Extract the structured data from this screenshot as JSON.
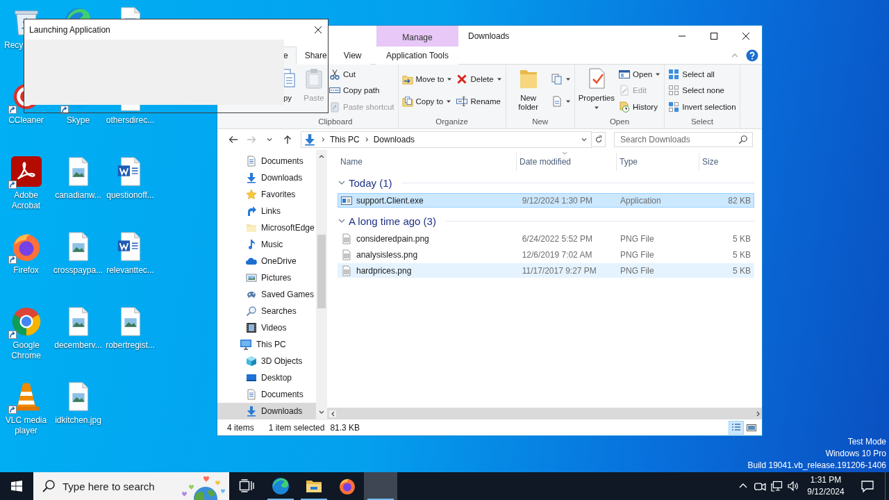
{
  "desktop": {
    "icons": [
      {
        "kind": "recycle",
        "label": "Recy",
        "shortcut": false
      },
      {
        "kind": "ccleaner",
        "label": "CCleaner",
        "shortcut": true
      },
      {
        "kind": "acrobat",
        "label": "Adobe Acrobat",
        "shortcut": true
      },
      {
        "kind": "firefox",
        "label": "Firefox",
        "shortcut": true
      },
      {
        "kind": "chrome",
        "label": "Google Chrome",
        "shortcut": true
      },
      {
        "kind": "vlc",
        "label": "VLC media player",
        "shortcut": true
      },
      {
        "kind": "edge",
        "shortcut": false
      },
      {
        "kind": "skype",
        "label": "Skype",
        "shortcut": true
      },
      {
        "kind": "image",
        "label": "canadianw...",
        "shortcut": false
      },
      {
        "kind": "image",
        "label": "crosspaypa...",
        "shortcut": false
      },
      {
        "kind": "image",
        "label": "decemberv...",
        "shortcut": false
      },
      {
        "kind": "image",
        "label": "idkitchen.jpg",
        "shortcut": false
      },
      {
        "kind": "image",
        "shortcut": false
      },
      {
        "kind": "image",
        "label": "othersdirec...",
        "shortcut": false
      },
      {
        "kind": "word",
        "label": "questionoff...",
        "shortcut": false
      },
      {
        "kind": "word",
        "label": "relevanttec...",
        "shortcut": false
      },
      {
        "kind": "image",
        "label": "robertregist...",
        "shortcut": false
      }
    ],
    "system_lines": [
      "Test Mode",
      "Windows 10 Pro",
      "Build 19041.vb_release.191206-1406"
    ]
  },
  "dialog": {
    "title": "Launching Application"
  },
  "explorer": {
    "context_header": "Manage",
    "title": "Downloads",
    "tabs": [
      {
        "label": "e",
        "kind": "normal",
        "selected": true
      },
      {
        "label": "Share",
        "kind": "normal",
        "selected": false
      },
      {
        "label": "View",
        "kind": "normal",
        "selected": false
      },
      {
        "label": "Application Tools",
        "kind": "context",
        "selected": false
      }
    ],
    "ribbon": [
      {
        "label": "Clipboard",
        "columns": [
          {
            "kind": "large",
            "buttons": [
              {
                "kind": "copy",
                "label": "py",
                "disabled": false,
                "dropdown": false
              }
            ]
          },
          {
            "kind": "large",
            "buttons": [
              {
                "kind": "paste",
                "label": "Paste",
                "disabled": true,
                "dropdown": false
              }
            ]
          },
          {
            "kind": "small",
            "buttons": [
              {
                "kind": "cut",
                "label": "Cut",
                "disabled": false,
                "dropdown": false
              },
              {
                "kind": "copypath",
                "label": "Copy path",
                "disabled": false,
                "dropdown": false
              },
              {
                "kind": "pasteshortcut",
                "label": "Paste shortcut",
                "disabled": true,
                "dropdown": false
              }
            ]
          }
        ]
      },
      {
        "label": "Organize",
        "columns": [
          {
            "kind": "small",
            "buttons": [
              {
                "kind": "moveto",
                "label": "Move to",
                "disabled": false,
                "dropdown": true
              },
              {
                "kind": "copyto",
                "label": "Copy to",
                "disabled": false,
                "dropdown": true
              }
            ]
          },
          {
            "kind": "small",
            "buttons": [
              {
                "kind": "delete",
                "label": "Delete",
                "disabled": false,
                "dropdown": true
              },
              {
                "kind": "rename",
                "label": "Rename",
                "disabled": false,
                "dropdown": false
              }
            ]
          }
        ]
      },
      {
        "label": "New",
        "columns": [
          {
            "kind": "large",
            "buttons": [
              {
                "kind": "newfolder",
                "label": "New folder",
                "disabled": false,
                "dropdown": false
              }
            ]
          },
          {
            "kind": "small",
            "buttons": [
              {
                "kind": "newitem",
                "disabled": false,
                "dropdown": true
              },
              {
                "kind": "easyaccess",
                "disabled": false,
                "dropdown": true
              }
            ]
          }
        ]
      },
      {
        "label": "Open",
        "columns": [
          {
            "kind": "large",
            "buttons": [
              {
                "kind": "properties",
                "label": "Properties",
                "disabled": false,
                "dropdown": true
              }
            ]
          },
          {
            "kind": "small",
            "buttons": [
              {
                "kind": "open",
                "label": "Open",
                "disabled": false,
                "dropdown": true
              },
              {
                "kind": "edit",
                "label": "Edit",
                "disabled": true,
                "dropdown": false
              },
              {
                "kind": "history",
                "label": "History",
                "disabled": false,
                "dropdown": false
              }
            ]
          }
        ]
      },
      {
        "label": "Select",
        "columns": [
          {
            "kind": "small",
            "buttons": [
              {
                "kind": "selectall",
                "label": "Select all",
                "disabled": false,
                "dropdown": false
              },
              {
                "kind": "selectnone",
                "label": "Select none",
                "disabled": false,
                "dropdown": false
              },
              {
                "kind": "invert",
                "label": "Invert selection",
                "disabled": false,
                "dropdown": false
              }
            ]
          }
        ]
      }
    ],
    "nav_buttons": [
      {
        "kind": "back",
        "disabled": false
      },
      {
        "kind": "forward",
        "disabled": true
      },
      {
        "kind": "recent",
        "disabled": false
      },
      {
        "kind": "up",
        "disabled": false
      }
    ],
    "path": [
      "This PC",
      "Downloads"
    ],
    "search": {
      "placeholder": "Search Downloads"
    },
    "nav_pane": [
      {
        "children": [
          {
            "kind": "documents",
            "label": "Documents",
            "selected": false
          },
          {
            "kind": "downloads",
            "label": "Downloads",
            "selected": false
          },
          {
            "kind": "star",
            "label": "Favorites",
            "selected": false
          },
          {
            "kind": "links",
            "label": "Links",
            "selected": false
          },
          {
            "kind": "folder",
            "label": "MicrosoftEdge",
            "selected": false
          },
          {
            "kind": "music",
            "label": "Music",
            "selected": false
          },
          {
            "kind": "onedrive",
            "label": "OneDrive",
            "selected": false
          },
          {
            "kind": "pictures",
            "label": "Pictures",
            "selected": false
          },
          {
            "kind": "games",
            "label": "Saved Games",
            "selected": false
          },
          {
            "kind": "searches",
            "label": "Searches",
            "selected": false
          },
          {
            "kind": "videos",
            "label": "Videos",
            "selected": false
          }
        ]
      },
      {
        "kind": "thispc",
        "label": "This PC",
        "selected": false,
        "children": [
          {
            "kind": "objects3d",
            "label": "3D Objects",
            "selected": false
          },
          {
            "kind": "desktop",
            "label": "Desktop",
            "selected": false
          },
          {
            "kind": "documents",
            "label": "Documents",
            "selected": false
          },
          {
            "kind": "downloads",
            "label": "Downloads",
            "selected": true
          }
        ]
      }
    ],
    "columns": [
      {
        "label": "Name",
        "sorted": false
      },
      {
        "label": "Date modified",
        "sorted": true
      },
      {
        "label": "Type",
        "sorted": false
      },
      {
        "label": "Size",
        "sorted": false
      }
    ],
    "groups": [
      {
        "label": "Today (1)",
        "expanded": true,
        "rows": [
          {
            "kind": "exe",
            "name": "support.Client.exe",
            "date": "9/12/2024 1:30 PM",
            "type": "Application",
            "size": "82 KB",
            "selected": true,
            "hovered": false
          }
        ]
      },
      {
        "label": "A long time ago (3)",
        "expanded": true,
        "rows": [
          {
            "kind": "png",
            "name": "consideredpain.png",
            "date": "6/24/2022 5:52 PM",
            "type": "PNG File",
            "size": "5 KB",
            "selected": false,
            "hovered": false
          },
          {
            "kind": "png",
            "name": "analysisless.png",
            "date": "12/6/2019 7:02 AM",
            "type": "PNG File",
            "size": "5 KB",
            "selected": false,
            "hovered": false
          },
          {
            "kind": "png",
            "name": "hardprices.png",
            "date": "11/17/2017 9:27 PM",
            "type": "PNG File",
            "size": "5 KB",
            "selected": false,
            "hovered": true
          }
        ]
      }
    ],
    "status": {
      "items": "4 items",
      "selection": "1 item selected",
      "selection_size": "81.3 KB",
      "views": [
        {
          "kind": "details",
          "selected": true
        },
        {
          "kind": "tiles",
          "selected": false
        }
      ]
    }
  },
  "taskbar": {
    "search": {
      "placeholder": "Type here to search"
    },
    "apps": [
      {
        "kind": "taskview",
        "running": false,
        "active": false
      },
      {
        "kind": "edge",
        "running": true,
        "active": false
      },
      {
        "kind": "explorer",
        "running": true,
        "active": false
      },
      {
        "kind": "firefox",
        "running": false,
        "active": false
      },
      {
        "kind": "blank",
        "running": true,
        "active": true
      }
    ],
    "clock": {
      "time": "1:31 PM",
      "date": "9/12/2024"
    }
  }
}
